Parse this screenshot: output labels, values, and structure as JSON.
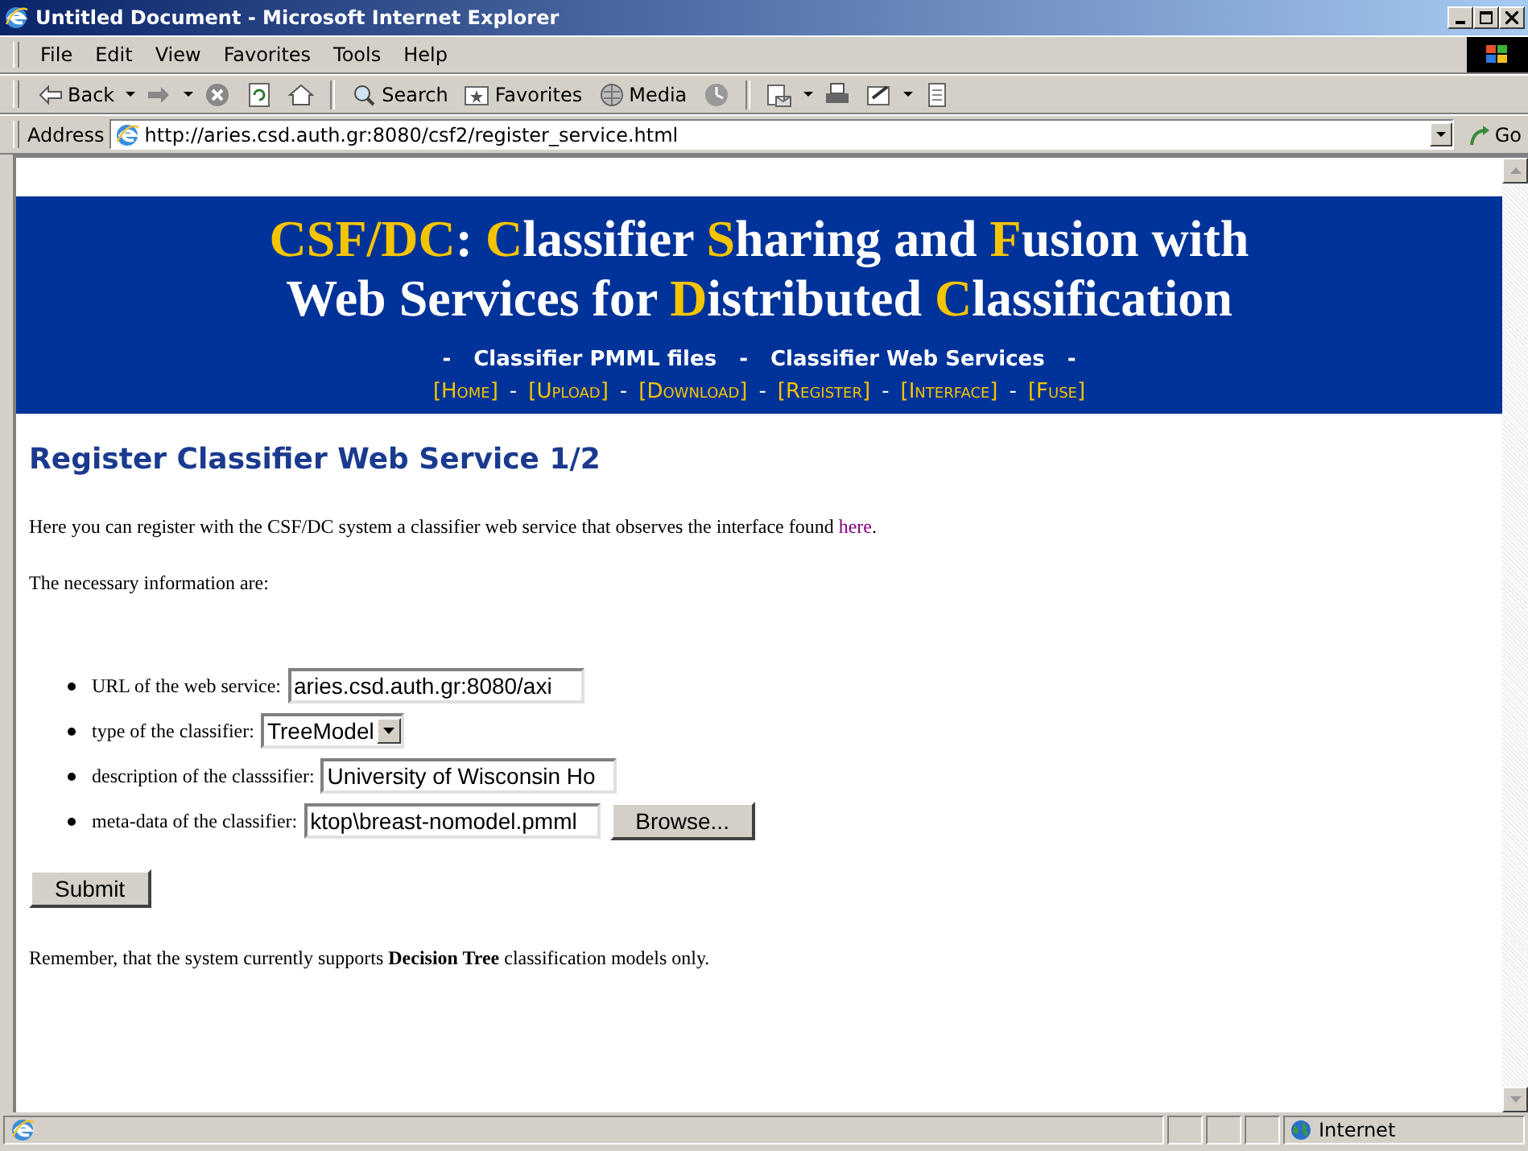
{
  "window": {
    "title": "Untitled Document - Microsoft Internet Explorer"
  },
  "menu": [
    "File",
    "Edit",
    "View",
    "Favorites",
    "Tools",
    "Help"
  ],
  "toolbar": {
    "back": "Back",
    "search": "Search",
    "favorites": "Favorites",
    "media": "Media"
  },
  "address": {
    "label": "Address",
    "url": "http://aries.csd.auth.gr:8080/csf2/register_service.html",
    "go": "Go"
  },
  "banner": {
    "title_lines": [
      [
        {
          "text": "CSF/DC",
          "accent": true
        },
        {
          "text": ": ",
          "accent": false
        },
        {
          "text": "C",
          "accent": true
        },
        {
          "text": "lassifier ",
          "accent": false
        },
        {
          "text": "S",
          "accent": true
        },
        {
          "text": "haring and ",
          "accent": false
        },
        {
          "text": "F",
          "accent": true
        },
        {
          "text": "usion with",
          "accent": false
        }
      ],
      [
        {
          "text": "Web Services for ",
          "accent": false
        },
        {
          "text": "D",
          "accent": true
        },
        {
          "text": "istributed ",
          "accent": false
        },
        {
          "text": "C",
          "accent": true
        },
        {
          "text": "lassification",
          "accent": false
        }
      ]
    ],
    "separator": "-",
    "sections": [
      "Classifier PMML files",
      "Classifier Web Services"
    ],
    "nav": [
      "[Home]",
      "[Upload]",
      "[Download]",
      "[Register]",
      "[Interface]",
      "[Fuse]"
    ]
  },
  "page": {
    "heading": "Register Classifier Web Service 1/2",
    "intro": "Here you can register with the CSF/DC system a classifier web service that observes the interface found ",
    "intro_link": "here",
    "intro_end": ".",
    "lead": "The necessary information are:",
    "fields": [
      {
        "kind": "text",
        "label": "URL of the web service:",
        "value": "aries.csd.auth.gr:8080/axi"
      },
      {
        "kind": "select",
        "label": "type of the classifier:",
        "value": "TreeModel"
      },
      {
        "kind": "text",
        "label": "description of the classsifier:",
        "value": "University of Wisconsin Ho"
      },
      {
        "kind": "file",
        "label": "meta-data of the classifier:",
        "value": "ktop\\breast-nomodel.pmml",
        "button": "Browse..."
      }
    ],
    "submit": "Submit",
    "note": "Remember, that the system currently supports **Decision Tree** classification models only."
  },
  "status_bar": {
    "zone": "Internet"
  }
}
